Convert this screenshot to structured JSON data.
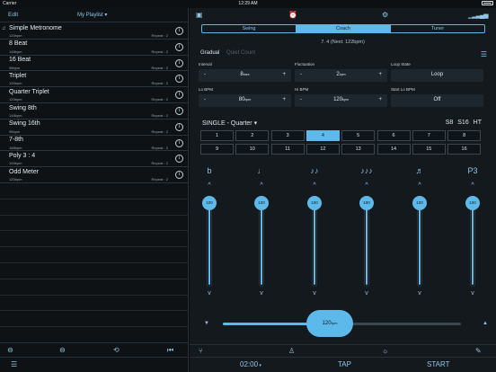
{
  "status": {
    "carrier": "Carrier",
    "time": "12:29 AM"
  },
  "left": {
    "edit": "Edit",
    "playlist": "My Playlist",
    "items": [
      {
        "title": "Simple Metronome",
        "bpm": "120bpm",
        "repeat": "Repeat : 2",
        "playing": true
      },
      {
        "title": "8 Beat",
        "bpm": "148bpm",
        "repeat": "Repeat : 2"
      },
      {
        "title": "16 Beat",
        "bpm": "96bpm",
        "repeat": "Repeat : 2"
      },
      {
        "title": "Triplet",
        "bpm": "100bpm",
        "repeat": "Repeat : 2"
      },
      {
        "title": "Quarter Triplet",
        "bpm": "120bpm",
        "repeat": "Repeat : 2"
      },
      {
        "title": "Swing 8th",
        "bpm": "148bpm",
        "repeat": "Repeat : 2"
      },
      {
        "title": "Swing 16th",
        "bpm": "96bpm",
        "repeat": "Repeat : 2"
      },
      {
        "title": "7-8th",
        "bpm": "168bpm",
        "repeat": "Repeat : 2"
      },
      {
        "title": "Poly 3 : 4",
        "bpm": "100bpm",
        "repeat": "Repeat : 2"
      },
      {
        "title": "Odd Meter",
        "bpm": "120bpm",
        "repeat": "Repeat : 2"
      }
    ],
    "info_glyph": "i"
  },
  "right": {
    "tabs": [
      "Swing",
      "Coach",
      "Tuner"
    ],
    "active_tab": 1,
    "counter": "7. 4 (Next: 122bpm)",
    "subtabs": {
      "gradual": "Gradual",
      "quiet": "Quiet Count"
    },
    "params": {
      "interval": {
        "label": "Interval",
        "value": "8",
        "unit": "bars"
      },
      "fluctuation": {
        "label": "Fluctuation",
        "value": "2",
        "unit": "bpm"
      },
      "loop_state": {
        "label": "Loop State",
        "value": "Loop"
      },
      "lo_bpm": {
        "label": "Lo BPM",
        "value": "80",
        "unit": "bpm"
      },
      "hi_bpm": {
        "label": "Hi BPM",
        "value": "120",
        "unit": "bpm"
      },
      "start_lo": {
        "label": "Start Lo BPM",
        "value": "Off"
      }
    },
    "single_label": "SINGLE - Quarter",
    "subdivisions": "S8 S16 HT",
    "beats": [
      "1",
      "2",
      "3",
      "4",
      "5",
      "6",
      "7",
      "8",
      "9",
      "10",
      "11",
      "12",
      "13",
      "14",
      "15",
      "16"
    ],
    "active_beat": 4,
    "note_icons": [
      "b",
      "♩",
      "♪♪",
      "♪♪♪",
      "♬",
      "P3"
    ],
    "sliders": [
      {
        "value": "100",
        "level": 1.0
      },
      {
        "value": "100",
        "level": 1.0
      },
      {
        "value": "100",
        "level": 1.0
      },
      {
        "value": "100",
        "level": 1.0
      },
      {
        "value": "100",
        "level": 1.0
      },
      {
        "value": "100",
        "level": 1.0
      }
    ],
    "tempo": {
      "value": "120",
      "unit": "bpm",
      "level": 0.45
    },
    "bottom": {
      "time": "02:00",
      "tap": "TAP",
      "start": "START"
    }
  },
  "colors": {
    "accent": "#5db9ea",
    "background": "#14191d"
  }
}
